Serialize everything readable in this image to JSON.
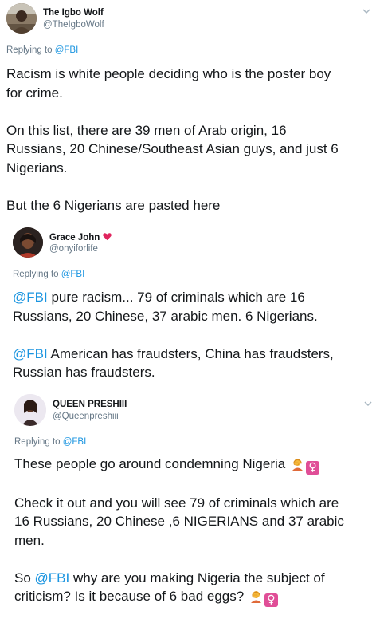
{
  "tweets": [
    {
      "name": "The Igbo Wolf",
      "handle": "@TheIgboWolf",
      "replying_prefix": "Replying to ",
      "replying_to": "@FBI",
      "lines": [
        "Racism is white people deciding who is the poster boy",
        "for crime.",
        "",
        "On this list, there are 39 men of Arab origin, 16",
        "Russians, 20 Chinese/Southeast Asian guys, and just 6",
        "Nigerians.",
        "",
        "But the 6 Nigerians are pasted here"
      ]
    },
    {
      "name": "Grace John",
      "name_emoji": "heart-icon",
      "handle": "@onyiforlife",
      "replying_prefix": "Replying to ",
      "replying_to": "@FBI",
      "p1_mention": "@FBI",
      "p1_line1": " pure racism... 79 of criminals which are 16",
      "p1_line2": "Russians, 20 Chinese, 37 arabic men. 6 Nigerians.",
      "p2_mention": "@FBI",
      "p2_line1": " American has fraudsters, China has fraudsters,",
      "p2_line2": "Russian has fraudsters."
    },
    {
      "name": "QUEEN PRESHIII",
      "handle": "@Queenpreshiii",
      "replying_prefix": "Replying to ",
      "replying_to": "@FBI",
      "l1": "These people go around condemning Nigeria",
      "l3": "Check it out and you will see 79 of criminals which are",
      "l4": "16 Russians, 20 Chinese ,6 NIGERIANS and 37 arabic",
      "l5": "men.",
      "l7_prefix": "So ",
      "l7_mention": "@FBI",
      "l7_rest": " why are you making Nigeria the subject of",
      "l8": "criticism? Is it because of 6 bad eggs?",
      "emoji_female_glyph": "♀",
      "emoji_names": [
        "woman-facepalming-icon",
        "female-sign-icon"
      ]
    }
  ],
  "colors": {
    "link": "#1b95e0",
    "secondary": "#657786",
    "text": "#14171a",
    "heart": "#e0245e",
    "emoji_skin": "#f5b93a",
    "emoji_hair": "#d98c1e",
    "female_sign_bg": "#e04e97"
  }
}
